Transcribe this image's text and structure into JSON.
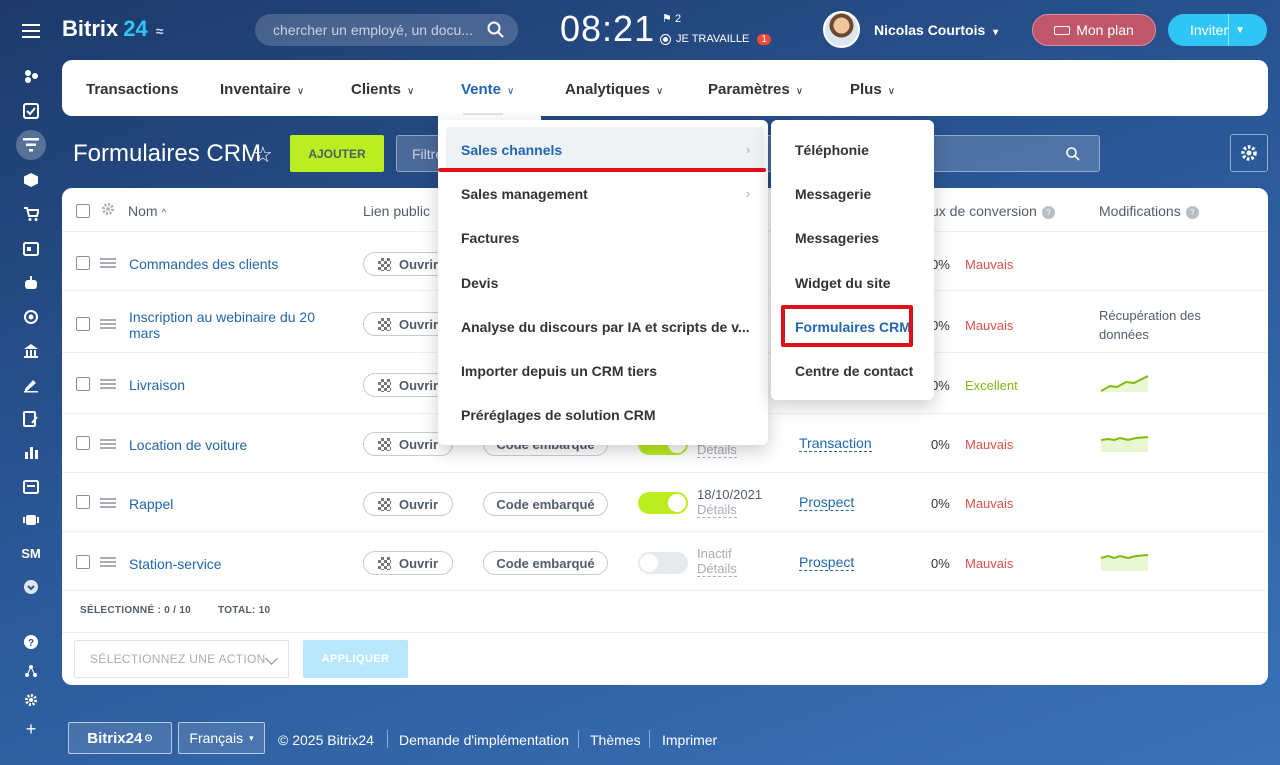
{
  "brand": {
    "name": "Bitrix",
    "number": "24"
  },
  "search": {
    "placeholder": "chercher un employé, un docu..."
  },
  "clock": {
    "time": "08:21",
    "flag_count": "2",
    "status": "JE TRAVAILLE",
    "status_badge": "1"
  },
  "user": {
    "name": "Nicolas Courtois"
  },
  "plan_label": "Mon plan",
  "invite_label": "Inviter",
  "sidebar_sm": "SM",
  "nav": {
    "items": [
      {
        "label": "Transactions"
      },
      {
        "label": "Inventaire"
      },
      {
        "label": "Clients"
      },
      {
        "label": "Vente"
      },
      {
        "label": "Analytiques"
      },
      {
        "label": "Paramètres"
      },
      {
        "label": "Plus"
      }
    ],
    "active": "Vente"
  },
  "page": {
    "title": "Formulaires CRM",
    "add_label": "AJOUTER",
    "filter_placeholder": "Filtre"
  },
  "table": {
    "columns": {
      "name": "Nom",
      "public_link": "Lien public",
      "conversion": "ux de conversion",
      "modifications": "Modifications"
    },
    "open_label": "Ouvrir",
    "code_label": "Code embarqué",
    "details_label": "Détails",
    "rows": [
      {
        "name": "Commandes des clients",
        "pct": "0%",
        "conv": "Mauvais",
        "mod": ""
      },
      {
        "name": "Inscription au webinaire du 20",
        "name2": "mars",
        "pct": "0%",
        "conv": "Mauvais",
        "mod": "Récupération des",
        "mod2": "données"
      },
      {
        "name": "Livraison",
        "pct": "0%",
        "conv": "Excellent",
        "mod": ""
      },
      {
        "name": "Location de voiture",
        "entity": "Transaction",
        "pct": "0%",
        "conv": "Mauvais",
        "mod": ""
      },
      {
        "name": "Rappel",
        "date": "18/10/2021",
        "entity": "Prospect",
        "pct": "0%",
        "conv": "Mauvais",
        "mod": ""
      },
      {
        "name": "Station-service",
        "date": "Inactif",
        "entity": "Prospect",
        "pct": "0%",
        "conv": "Mauvais",
        "mod": ""
      }
    ]
  },
  "footer_table": {
    "selected_label": "SÉLECTIONNÉ : ",
    "selected": "0 / 10",
    "total_label": "TOTAL: ",
    "total": "10",
    "action_placeholder": "SÉLECTIONNEZ UNE ACTION",
    "apply_label": "APPLIQUER"
  },
  "menu": {
    "level1": [
      {
        "label": "Sales channels",
        "has_sub": true
      },
      {
        "label": "Sales management",
        "has_sub": true
      },
      {
        "label": "Factures"
      },
      {
        "label": "Devis"
      },
      {
        "label": "Analyse du discours par IA et scripts de v..."
      },
      {
        "label": "Importer depuis un CRM tiers"
      },
      {
        "label": "Préréglages de solution CRM"
      }
    ],
    "level2": [
      {
        "label": "Téléphonie"
      },
      {
        "label": "Messagerie"
      },
      {
        "label": "Messageries"
      },
      {
        "label": "Widget du site"
      },
      {
        "label": "Formulaires CRM"
      },
      {
        "label": "Centre de contact"
      }
    ]
  },
  "footer": {
    "brand": "Bitrix24",
    "language": "Français",
    "copyright": "© 2025 Bitrix24",
    "links": [
      "Demande d'implémentation",
      "Thèmes",
      "Imprimer"
    ]
  },
  "colors": {
    "accent": "#2fc6f6",
    "add_button": "#bbed21",
    "link": "#2066b0",
    "bad": "#e2504c",
    "good": "#7fbb14",
    "highlight_red": "#e0101b"
  }
}
